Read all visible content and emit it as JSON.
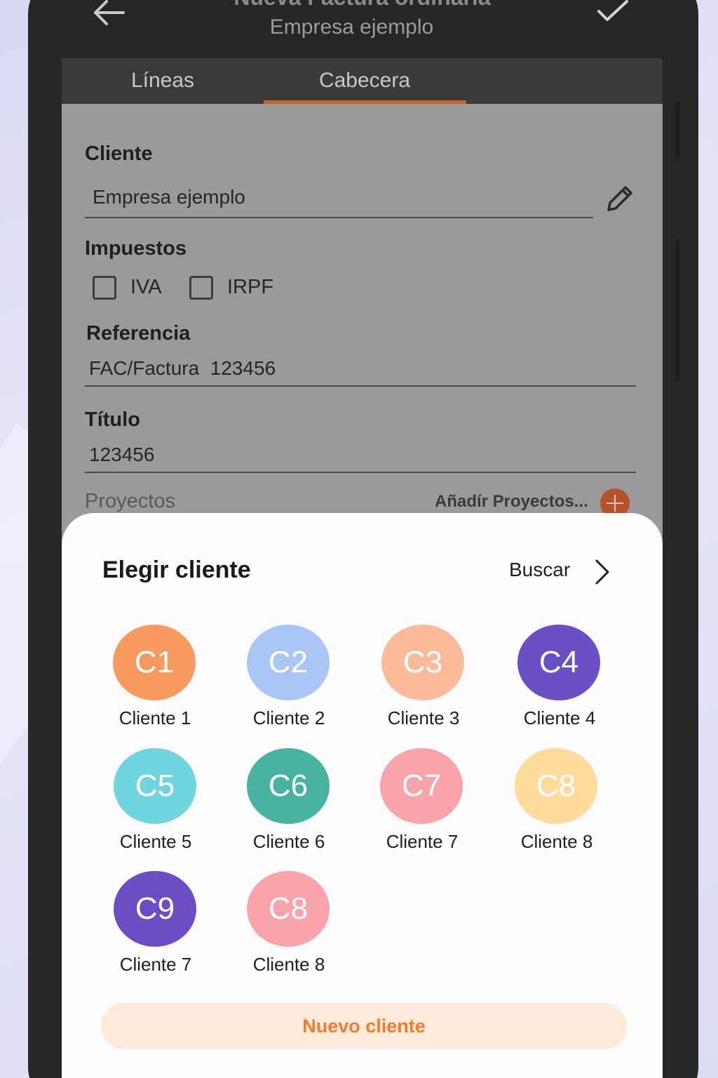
{
  "header": {
    "title": "Nueva Factura ordinaria",
    "subtitle": "Empresa ejemplo"
  },
  "tabs": [
    {
      "label": "Líneas",
      "active": false
    },
    {
      "label": "Cabecera",
      "active": true
    }
  ],
  "form": {
    "client_label": "Cliente",
    "client_value": "Empresa ejemplo",
    "taxes_label": "Impuestos",
    "taxes": [
      {
        "label": "IVA",
        "checked": false
      },
      {
        "label": "IRPF",
        "checked": false
      }
    ],
    "reference_label": "Referencia",
    "reference_value": "FAC/Factura  123456",
    "title_label": "Título",
    "title_value": "123456",
    "projects_label": "Proyectos",
    "add_projects_label": "Añadír Proyectos..."
  },
  "sheet": {
    "title": "Elegir cliente",
    "search_label": "Buscar",
    "clients": [
      {
        "initials": "C1",
        "name": "Cliente 1",
        "color": "#f79a5e"
      },
      {
        "initials": "C2",
        "name": "Cliente 2",
        "color": "#a9c6f7"
      },
      {
        "initials": "C3",
        "name": "Cliente 3",
        "color": "#fbbb98"
      },
      {
        "initials": "C4",
        "name": "Cliente 4",
        "color": "#6a4fc7"
      },
      {
        "initials": "C5",
        "name": "Cliente 5",
        "color": "#71d5e0"
      },
      {
        "initials": "C6",
        "name": "Cliente 6",
        "color": "#49b3a2"
      },
      {
        "initials": "C7",
        "name": "Cliente 7",
        "color": "#f9a4aa"
      },
      {
        "initials": "C8",
        "name": "Cliente 8",
        "color": "#fedb9b"
      },
      {
        "initials": "C9",
        "name": "Cliente 7",
        "color": "#6b4dc4"
      },
      {
        "initials": "C8",
        "name": "Cliente 8",
        "color": "#f9a4aa"
      }
    ],
    "new_client_label": "Nuevo cliente"
  },
  "colors": {
    "accent": "#f47b2a",
    "header_bg": "#262626",
    "tab_indicator": "#c5652a"
  }
}
